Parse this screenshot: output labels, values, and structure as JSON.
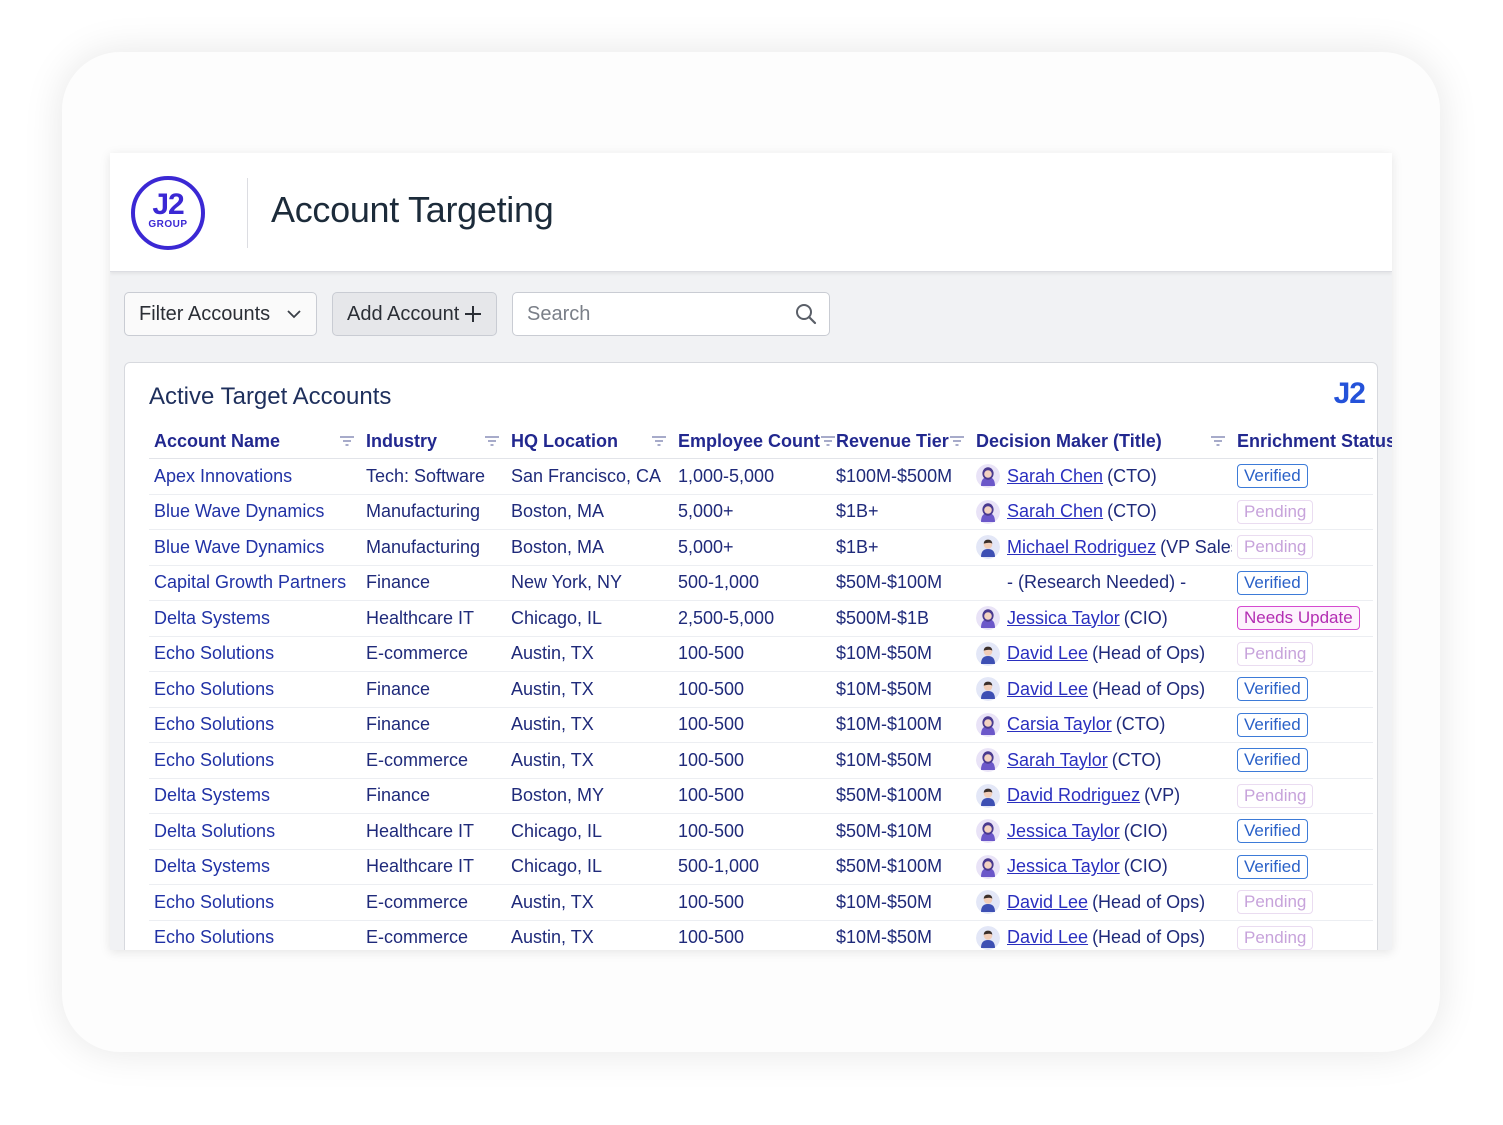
{
  "app": {
    "logo_main": "J2",
    "logo_sub": "GROUP",
    "title": "Account Targeting"
  },
  "toolbar": {
    "filter_label": "Filter Accounts",
    "add_label": "Add Account",
    "search_placeholder": "Search"
  },
  "panel": {
    "title": "Active Target Accounts",
    "logo": "J2"
  },
  "table": {
    "columns": [
      "Account Name",
      "Industry",
      "HQ Location",
      "Employee Count",
      "Revenue Tier",
      "Decision Maker (Title)",
      "Enrichment Status"
    ],
    "rows": [
      {
        "account": "Apex Innovations",
        "industry": "Tech: Software",
        "location": "San Francisco, CA",
        "employees": "1,000-5,000",
        "revenue": "$100M-$500M",
        "dm_name": "Sarah Chen",
        "dm_title": "(CTO)",
        "avatar": "female",
        "status": "Verified",
        "status_type": "verified"
      },
      {
        "account": "Blue Wave Dynamics",
        "industry": "Manufacturing",
        "location": "Boston, MA",
        "employees": "5,000+",
        "revenue": "$1B+",
        "dm_name": "Sarah Chen",
        "dm_title": "(CTO)",
        "avatar": "female",
        "status": "Pending",
        "status_type": "pending"
      },
      {
        "account": "Blue Wave Dynamics",
        "industry": "Manufacturing",
        "location": "Boston, MA",
        "employees": "5,000+",
        "revenue": "$1B+",
        "dm_name": "Michael Rodriguez",
        "dm_title": "(VP Sales)",
        "avatar": "male",
        "status": "Pending",
        "status_type": "pending"
      },
      {
        "account": "Capital Growth Partners",
        "industry": "Finance",
        "location": "New York, NY",
        "employees": "500-1,000",
        "revenue": "$50M-$100M",
        "dm_name": "",
        "dm_title": "",
        "dm_text": "- (Research Needed) -",
        "avatar": "",
        "status": "Verified",
        "status_type": "verified"
      },
      {
        "account": "Delta Systems",
        "industry": "Healthcare IT",
        "location": "Chicago, IL",
        "employees": "2,500-5,000",
        "revenue": "$500M-$1B",
        "dm_name": "Jessica Taylor",
        "dm_title": "(CIO)",
        "avatar": "female",
        "status": "Needs Update",
        "status_type": "update"
      },
      {
        "account": "Echo Solutions",
        "industry": "E-commerce",
        "location": "Austin, TX",
        "employees": "100-500",
        "revenue": "$10M-$50M",
        "dm_name": "David Lee",
        "dm_title": "(Head of Ops)",
        "avatar": "male",
        "status": "Pending",
        "status_type": "pending"
      },
      {
        "account": "Echo Solutions",
        "industry": "Finance",
        "location": "Austin, TX",
        "employees": "100-500",
        "revenue": "$10M-$50M",
        "dm_name": "David Lee",
        "dm_title": "(Head of Ops)",
        "avatar": "male",
        "status": "Verified",
        "status_type": "verified"
      },
      {
        "account": "Echo Solutions",
        "industry": "Finance",
        "location": "Austin, TX",
        "employees": "100-500",
        "revenue": "$10M-$100M",
        "dm_name": "Carsia Taylor",
        "dm_title": "(CTO)",
        "avatar": "female",
        "status": "Verified",
        "status_type": "verified"
      },
      {
        "account": "Echo Solutions",
        "industry": "E-commerce",
        "location": "Austin, TX",
        "employees": "100-500",
        "revenue": "$10M-$50M",
        "dm_name": "Sarah Taylor",
        "dm_title": "(CTO)",
        "avatar": "female",
        "status": "Verified",
        "status_type": "verified"
      },
      {
        "account": "Delta Systems",
        "industry": "Finance",
        "location": "Boston, MY",
        "employees": "100-500",
        "revenue": "$50M-$100M",
        "dm_name": "David Rodriguez",
        "dm_title": "(VP)",
        "avatar": "male",
        "status": "Pending",
        "status_type": "pending"
      },
      {
        "account": "Delta Solutions",
        "industry": "Healthcare IT",
        "location": "Chicago, IL",
        "employees": "100-500",
        "revenue": "$50M-$10M",
        "dm_name": "Jessica Taylor",
        "dm_title": "(CIO)",
        "avatar": "female",
        "status": "Verified",
        "status_type": "verified"
      },
      {
        "account": "Delta Systems",
        "industry": "Healthcare IT",
        "location": "Chicago, IL",
        "employees": "500-1,000",
        "revenue": "$50M-$100M",
        "dm_name": "Jessica Taylor",
        "dm_title": "(CIO)",
        "avatar": "female",
        "status": "Verified",
        "status_type": "verified"
      },
      {
        "account": "Echo Solutions",
        "industry": "E-commerce",
        "location": "Austin, TX",
        "employees": "100-500",
        "revenue": "$10M-$50M",
        "dm_name": "David Lee",
        "dm_title": "(Head of Ops)",
        "avatar": "male",
        "status": "Pending",
        "status_type": "pending"
      },
      {
        "account": "Echo Solutions",
        "industry": "E-commerce",
        "location": "Austin, TX",
        "employees": "100-500",
        "revenue": "$10M-$50M",
        "dm_name": "David Lee",
        "dm_title": "(Head of Ops)",
        "avatar": "male",
        "status": "Pending",
        "status_type": "pending"
      }
    ]
  },
  "colors": {
    "brand": "#3b28d4",
    "header_text": "#22288f",
    "verified": "#2a61c8",
    "pending": "#c7a3db",
    "needs_update": "#b32db2"
  }
}
